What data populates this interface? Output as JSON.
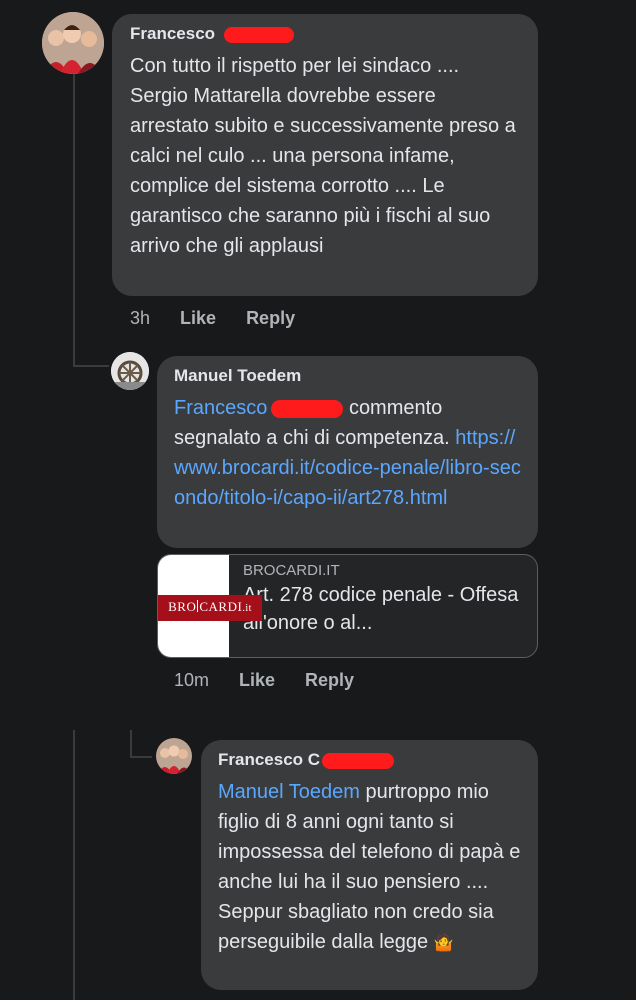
{
  "comments": [
    {
      "author": "Francesco",
      "text": "Con tutto il rispetto per lei sindaco .... Sergio Mattarella dovrebbe essere arrestato subito e successivamente preso a calci nel culo ... una persona infame, complice del sistema corrotto .... Le garantisco che saranno più i fischi al suo arrivo che gli applausi",
      "time": "3h",
      "like_label": "Like",
      "reply_label": "Reply"
    },
    {
      "author": "Manuel Toedem",
      "mention": "Francesco",
      "text_after_mention": "commento segnalato a chi di competenza.",
      "link_text": "https://www.brocardi.it/codice-penale/libro-secondo/titolo-i/capo-ii/art278.html",
      "preview": {
        "domain": "BROCARDI.IT",
        "title": "Art. 278 codice penale - Offesa all'onore o al...",
        "logo_left": "BRO",
        "logo_right": "CARDI",
        "logo_suffix": ".it"
      },
      "time": "10m",
      "like_label": "Like",
      "reply_label": "Reply"
    },
    {
      "author": "Francesco C",
      "mention": "Manuel Toedem",
      "text_after_mention": "purtroppo mio figlio di 8 anni ogni tanto si impossessa del telefono di papà e anche lui ha il suo pensiero .... Seppur sbagliato non credo sia perseguibile dalla legge",
      "emoji": "🤷"
    }
  ],
  "colors": {
    "background": "#18191a",
    "bubble": "#3a3b3c",
    "mention": "#5aa7ff",
    "redaction": "#ff1b1b"
  }
}
